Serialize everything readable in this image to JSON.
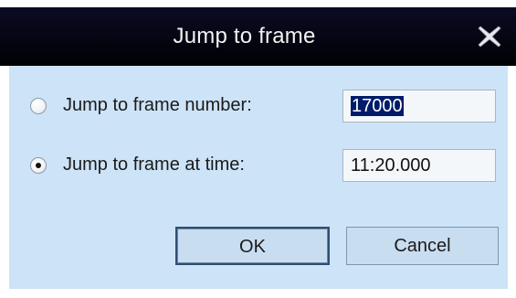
{
  "window": {
    "title": "Jump to frame",
    "close_icon": "close-x-icon"
  },
  "options": [
    {
      "label": "Jump to frame number:",
      "selected": false,
      "value": "17000",
      "value_highlighted": true
    },
    {
      "label": "Jump to frame at time:",
      "selected": true,
      "value": "11:20.000",
      "value_highlighted": false
    }
  ],
  "buttons": {
    "ok_label": "OK",
    "cancel_label": "Cancel"
  },
  "colors": {
    "title_bar": "#060614",
    "client_bg": "#cde3f7",
    "selection": "#001a6a"
  }
}
